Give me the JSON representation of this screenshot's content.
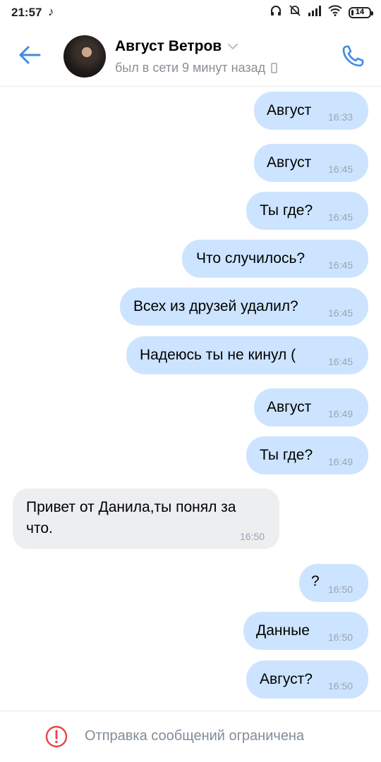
{
  "status_bar": {
    "time": "21:57",
    "battery": "14",
    "battery_fraction": 0.14
  },
  "header": {
    "contact_name": "Август Ветров",
    "status": "был в сети 9 минут назад"
  },
  "messages": [
    {
      "direction": "out",
      "text": "Август",
      "time": "16:33"
    },
    {
      "direction": "out",
      "text": "Август",
      "time": "16:45"
    },
    {
      "direction": "out",
      "text": "Ты где?",
      "time": "16:45"
    },
    {
      "direction": "out",
      "text": "Что случилось?",
      "time": "16:45"
    },
    {
      "direction": "out",
      "text": "Всех из друзей удалил?",
      "time": "16:45"
    },
    {
      "direction": "out",
      "text": "Надеюсь ты не кинул (",
      "time": "16:45"
    },
    {
      "direction": "out",
      "text": "Август",
      "time": "16:49"
    },
    {
      "direction": "out",
      "text": "Ты где?",
      "time": "16:49"
    },
    {
      "direction": "in",
      "text": "Привет от Данила,ты понял за что.",
      "time": "16:50"
    },
    {
      "direction": "out",
      "text": "?",
      "time": "16:50"
    },
    {
      "direction": "out",
      "text": "Данные",
      "time": "16:50"
    },
    {
      "direction": "out",
      "text": "Август?",
      "time": "16:50"
    }
  ],
  "footer": {
    "restriction_text": "Отправка сообщений ограничена"
  },
  "colors": {
    "accent": "#3f8ae0",
    "outgoing_bubble": "#cce4ff",
    "incoming_bubble": "#edeef0",
    "warning": "#e64646"
  }
}
